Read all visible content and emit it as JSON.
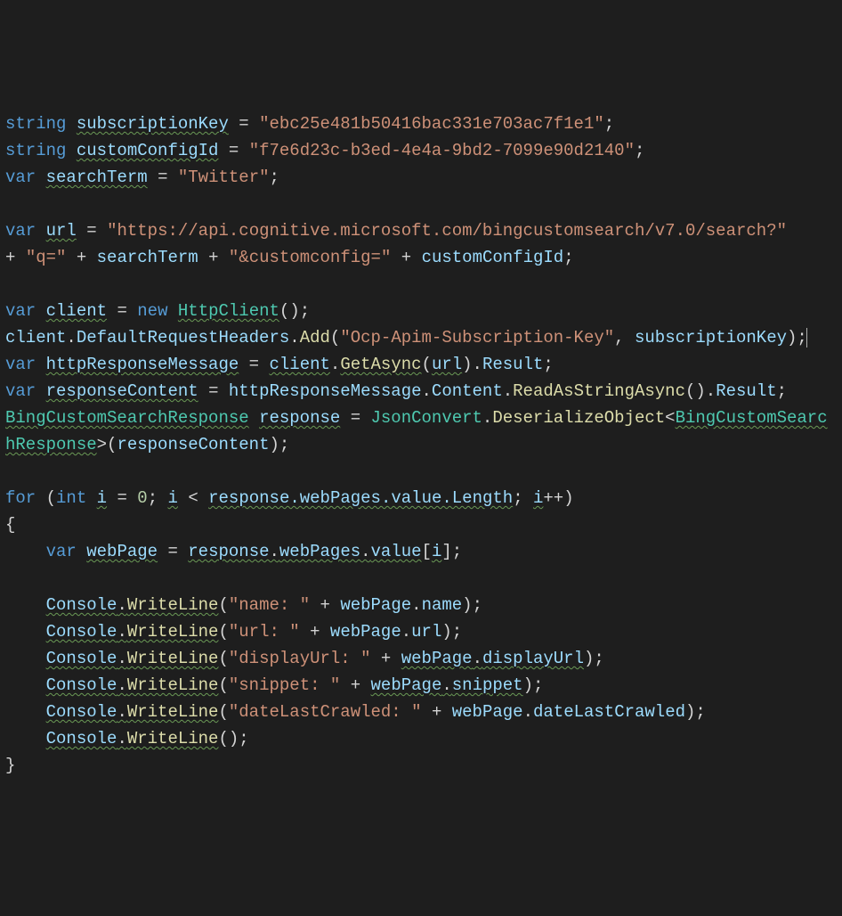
{
  "language": "csharp",
  "code": {
    "subscriptionKey": "ebc25e481b50416bac331e703ac7f1e1",
    "customConfigId": "f7e6d23c-b3ed-4e4a-9bd2-7099e90d2140",
    "searchTerm": "Twitter",
    "urlBase": "https://api.cognitive.microsoft.com/bingcustomsearch/v7.0/search?",
    "qParam": "q=",
    "configParam": "&customconfig=",
    "headerName": "Ocp-Apim-Subscription-Key",
    "loop": {
      "startValue": 0,
      "lengthPath": "response.webPages.value.Length",
      "indexVar": "i"
    },
    "outputLabels": {
      "name": "name: ",
      "url": "url: ",
      "displayUrl": "displayUrl: ",
      "snippet": "snippet: ",
      "dateLastCrawled": "dateLastCrawled: "
    },
    "identifiers": {
      "string": "string",
      "var": "var",
      "new": "new",
      "for": "for",
      "int": "int",
      "subscriptionKey": "subscriptionKey",
      "customConfigId": "customConfigId",
      "searchTerm": "searchTerm",
      "url": "url",
      "client": "client",
      "HttpClient": "HttpClient",
      "DefaultRequestHeaders": "DefaultRequestHeaders",
      "Add": "Add",
      "httpResponseMessage": "httpResponseMessage",
      "GetAsync": "GetAsync",
      "Result": "Result",
      "responseContent": "responseContent",
      "Content": "Content",
      "ReadAsStringAsync": "ReadAsStringAsync",
      "BingCustomSearchResponse": "BingCustomSearchResponse",
      "response": "response",
      "JsonConvert": "JsonConvert",
      "DeserializeObject": "DeserializeObject",
      "webPages": "webPages",
      "value": "value",
      "Length": "Length",
      "i": "i",
      "webPage": "webPage",
      "Console": "Console",
      "WriteLine": "WriteLine",
      "name": "name",
      "displayUrl": "displayUrl",
      "snippet": "snippet",
      "dateLastCrawled": "dateLastCrawled"
    }
  }
}
